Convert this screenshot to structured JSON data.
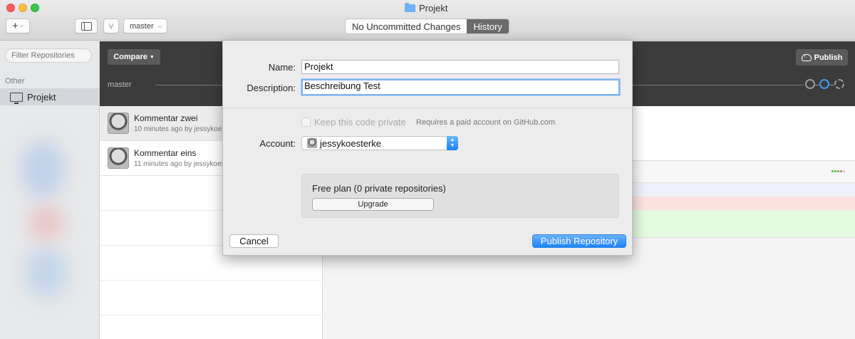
{
  "window": {
    "title": "Projekt"
  },
  "toolbar": {
    "add_label": "+",
    "branch": "master",
    "segments": [
      {
        "label": "No Uncommitted Changes"
      },
      {
        "label": "History"
      }
    ]
  },
  "sidebar": {
    "filter_placeholder": "Filter Repositories",
    "section": "Other",
    "items": [
      {
        "label": "Projekt"
      }
    ]
  },
  "header": {
    "compare_label": "Compare",
    "branch": "master",
    "publish_label": "Publish"
  },
  "history": {
    "commits": [
      {
        "title": "Kommentar zwei",
        "meta": "10 minutes ago by jessykoesterke"
      },
      {
        "title": "Kommentar eins",
        "meta": "11 minutes ago by jessykoesterke"
      }
    ]
  },
  "dialog": {
    "name_label": "Name:",
    "name_value": "Projekt",
    "description_label": "Description:",
    "description_value": "Beschreibung Test",
    "private_label": "Keep this code private",
    "private_note": "Requires a paid account on GitHub.com",
    "account_label": "Account:",
    "account_value": "jessykoesterke",
    "plan_text": "Free plan (0 private repositories)",
    "upgrade_label": "Upgrade",
    "cancel_label": "Cancel",
    "publish_label": "Publish Repository"
  },
  "colors": {
    "accent": "#1c84f6",
    "dark_header": "#3b3b3b",
    "added": "#e2fae0",
    "removed": "#fde0e0"
  }
}
